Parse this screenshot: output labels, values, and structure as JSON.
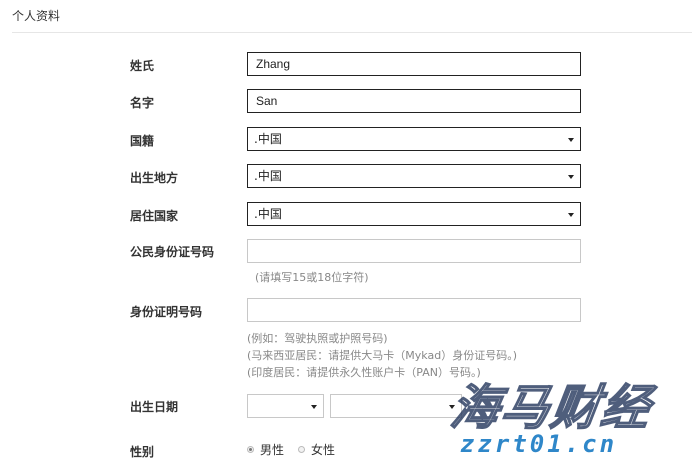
{
  "section": {
    "title": "个人资料"
  },
  "fields": {
    "surname": {
      "label": "姓氏",
      "value": "Zhang"
    },
    "given_name": {
      "label": "名字",
      "value": "San"
    },
    "nationality": {
      "label": "国籍",
      "value": ".中国"
    },
    "birth_place": {
      "label": "出生地方",
      "value": ".中国"
    },
    "residence_country": {
      "label": "居住国家",
      "value": ".中国"
    },
    "citizen_id": {
      "label": "公民身份证号码",
      "value": "",
      "hint": "(请填写15或18位字符)"
    },
    "id_number": {
      "label": "身份证明号码",
      "value": "",
      "hints": [
        "(例如：驾驶执照或护照号码)",
        "(马来西亚居民：请提供大马卡（Mykad）身份证号码。)",
        "(印度居民：请提供永久性账户卡（PAN）号码。)"
      ]
    },
    "birth_date": {
      "label": "出生日期",
      "day": "",
      "month": ""
    },
    "gender": {
      "label": "性别",
      "options": [
        "男性",
        "女性"
      ],
      "selected": "男性"
    }
  },
  "watermark": {
    "title": "海马财经",
    "url": "zzrt01.cn"
  },
  "icons": {
    "select_caret": "chevron-down-icon",
    "radio": "radio-icon"
  }
}
